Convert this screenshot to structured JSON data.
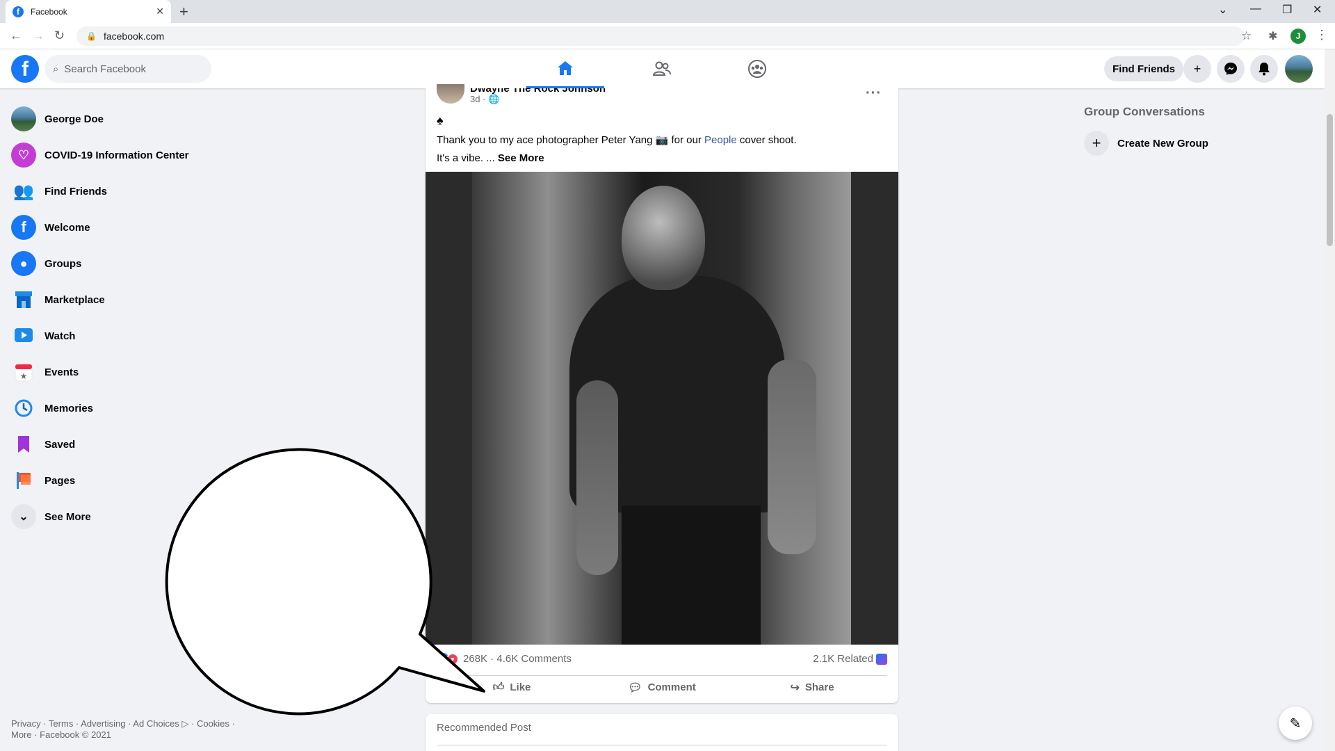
{
  "browser": {
    "tab_title": "Facebook",
    "tab_favicon": "f",
    "tab_close": "✕",
    "new_tab": "+",
    "url": "facebook.com",
    "profile_initial": "J",
    "window_controls": [
      "⌄",
      "—",
      "❐",
      "✕"
    ]
  },
  "topnav": {
    "logo": "f",
    "search_placeholder": "Search Facebook",
    "find_friends_label": "Find Friends"
  },
  "sidebar": {
    "items": [
      {
        "label": "George Doe",
        "icon": "avatar"
      },
      {
        "label": "COVID-19 Information Center",
        "icon": "heart-icon"
      },
      {
        "label": "Find Friends",
        "icon": "friends-icon"
      },
      {
        "label": "Welcome",
        "icon": "facebook-icon"
      },
      {
        "label": "Groups",
        "icon": "groups-icon"
      },
      {
        "label": "Marketplace",
        "icon": "shop-icon"
      },
      {
        "label": "Watch",
        "icon": "play-icon"
      },
      {
        "label": "Events",
        "icon": "calendar-star-icon"
      },
      {
        "label": "Memories",
        "icon": "clock-icon"
      },
      {
        "label": "Saved",
        "icon": "bookmark-icon"
      },
      {
        "label": "Pages",
        "icon": "flag-icon"
      },
      {
        "label": "See More",
        "icon": "chevron-down-icon"
      }
    ],
    "footer_line1": "Privacy · Terms · Advertising · Ad Choices ▷ · Cookies ·",
    "footer_line2": "More · Facebook © 2021"
  },
  "post": {
    "author": "Dwayne The Rock Johnson",
    "time": "3d · ",
    "more": "···",
    "spade": "♠",
    "text_before": "Thank you to my ace photographer Peter Yang 📷 for our ",
    "text_link": "People",
    "text_after": " cover shoot.",
    "text_line2": "It's a vibe. ... ",
    "see_more": "See More",
    "reaction_summary": "268K · 4.6K Comments",
    "related": "2.1K Related",
    "actions": {
      "like": "Like",
      "comment": "Comment",
      "share": "Share"
    }
  },
  "recommended": {
    "title": "Recommended Post"
  },
  "right": {
    "title": "Group Conversations",
    "create_group": "Create New Group"
  },
  "colors": {
    "accent": "#1877f2",
    "background": "#f0f2f5"
  }
}
